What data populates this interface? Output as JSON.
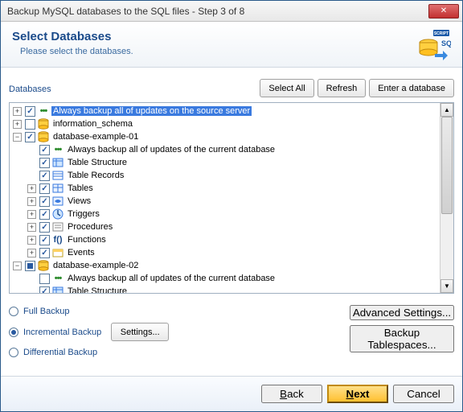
{
  "titlebar": {
    "title": "Backup MySQL databases to the SQL files - Step 3 of 8"
  },
  "header": {
    "heading": "Select Databases",
    "subtext": "Please select the databases."
  },
  "toolbar": {
    "section_label": "Databases",
    "select_all": "Select All",
    "refresh": "Refresh",
    "enter_db": "Enter a database"
  },
  "tree": [
    {
      "level": 0,
      "expander": "plus",
      "check": "checked",
      "icon": "dots",
      "label": "Always backup all of updates on the source server",
      "selected": true
    },
    {
      "level": 0,
      "expander": "plus",
      "check": "none",
      "icon": "db",
      "label": "information_schema"
    },
    {
      "level": 0,
      "expander": "minus",
      "check": "checked",
      "icon": "db",
      "label": "database-example-01"
    },
    {
      "level": 1,
      "expander": "blank",
      "check": "checked",
      "icon": "dots",
      "label": "Always backup all of updates of the current database"
    },
    {
      "level": 1,
      "expander": "blank",
      "check": "checked",
      "icon": "struct",
      "label": "Table Structure"
    },
    {
      "level": 1,
      "expander": "blank",
      "check": "checked",
      "icon": "records",
      "label": "Table Records"
    },
    {
      "level": 1,
      "expander": "plus",
      "check": "checked",
      "icon": "tables",
      "label": "Tables"
    },
    {
      "level": 1,
      "expander": "plus",
      "check": "checked",
      "icon": "views",
      "label": "Views"
    },
    {
      "level": 1,
      "expander": "plus",
      "check": "checked",
      "icon": "trig",
      "label": "Triggers"
    },
    {
      "level": 1,
      "expander": "plus",
      "check": "checked",
      "icon": "proc",
      "label": "Procedures"
    },
    {
      "level": 1,
      "expander": "plus",
      "check": "checked",
      "icon": "func",
      "label": "Functions"
    },
    {
      "level": 1,
      "expander": "plus",
      "check": "checked",
      "icon": "events",
      "label": "Events"
    },
    {
      "level": 0,
      "expander": "minus",
      "check": "partial",
      "icon": "db",
      "label": "database-example-02"
    },
    {
      "level": 1,
      "expander": "blank",
      "check": "none",
      "icon": "dots",
      "label": "Always backup all of updates of the current database"
    },
    {
      "level": 1,
      "expander": "blank",
      "check": "checked",
      "icon": "struct",
      "label": "Table Structure"
    }
  ],
  "options": {
    "full": "Full Backup",
    "incremental": "Incremental Backup",
    "differential": "Differential Backup",
    "settings": "Settings...",
    "advanced": "Advanced Settings...",
    "tablespaces": "Backup Tablespaces...",
    "selected": "incremental"
  },
  "footer": {
    "back": "Back",
    "next": "Next",
    "cancel": "Cancel"
  },
  "colors": {
    "accent": "#1a4a8a",
    "primary_btn": "#ffc030"
  }
}
